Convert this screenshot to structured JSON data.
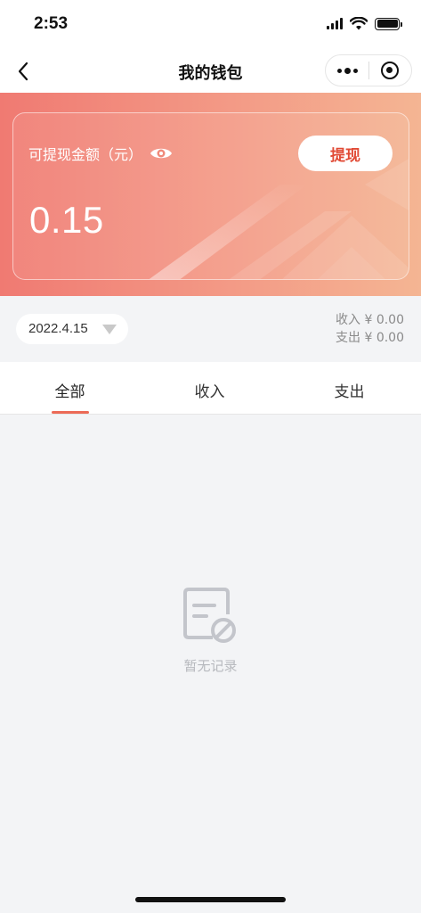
{
  "status_bar": {
    "time": "2:53"
  },
  "nav": {
    "title": "我的钱包"
  },
  "wallet": {
    "balance_label": "可提现金额（元）",
    "balance_value": "0.15",
    "withdraw_label": "提现"
  },
  "filter": {
    "date": "2022.4.15",
    "income_summary": "收入 ¥ 0.00",
    "expense_summary": "支出 ¥ 0.00"
  },
  "tabs": [
    {
      "label": "全部",
      "active": true
    },
    {
      "label": "收入",
      "active": false
    },
    {
      "label": "支出",
      "active": false
    }
  ],
  "empty_state": {
    "text": "暂无记录"
  },
  "colors": {
    "accent": "#ec6a56",
    "banner_start": "#f07a72",
    "banner_end": "#f4b593",
    "withdraw_text": "#e14a35"
  }
}
